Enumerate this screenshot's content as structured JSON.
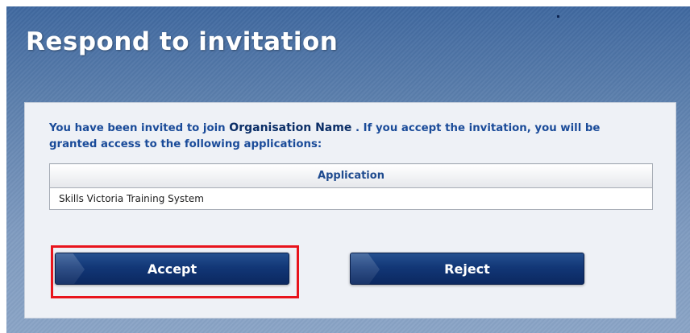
{
  "page": {
    "title": "Respond to invitation"
  },
  "invitation": {
    "message_prefix": "You have been invited to join",
    "organisation_name": "Organisation Name",
    "message_suffix": ". If you accept the invitation, you will be granted access to the following applications:"
  },
  "applications_table": {
    "column_header": "Application",
    "rows": [
      "Skills Victoria Training System"
    ]
  },
  "actions": {
    "accept_label": "Accept",
    "reject_label": "Reject"
  },
  "colors": {
    "title_text": "#ffffff",
    "message_text": "#1a4b99",
    "button_background": "#123777",
    "highlight_border": "#e8141c"
  }
}
